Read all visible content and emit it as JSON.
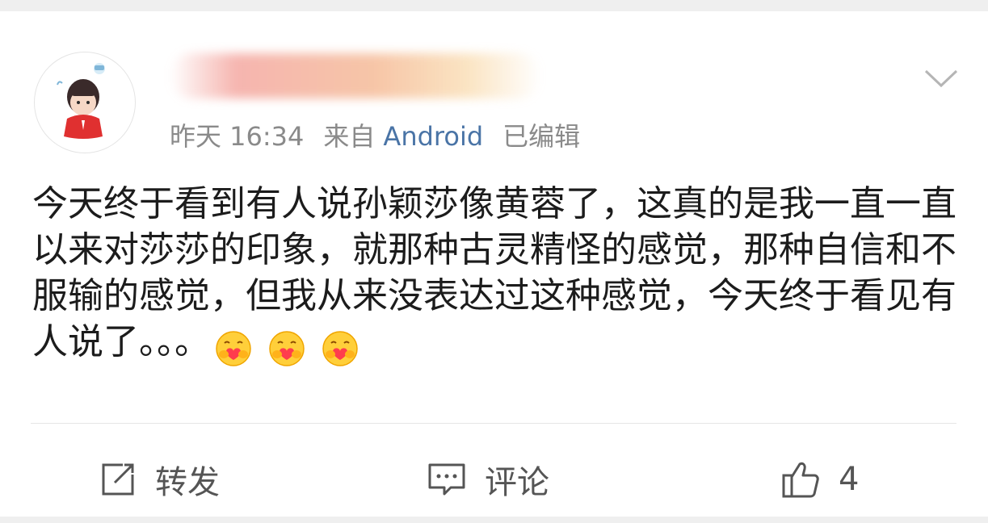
{
  "post": {
    "meta": {
      "time": "昨天 16:34",
      "source_prefix": "来自",
      "source": "Android",
      "edited": "已编辑"
    },
    "text": "今天终于看到有人说孙颖莎像黄蓉了，这真的是我一直一直以来对莎莎的印象，就那种古灵精怪的感觉，那种自信和不服输的感觉，但我从来没表达过这种感觉，今天终于看见有人说了。。。",
    "emoji_icon": "hug-heart-emoji",
    "emoji_count": 3
  },
  "actions": {
    "repost_label": "转发",
    "comment_label": "评论",
    "like_count": "4"
  },
  "colors": {
    "link": "#4a74a6",
    "meta": "#8a8a8a",
    "text": "#1c1c1c",
    "background": "#efefef"
  }
}
